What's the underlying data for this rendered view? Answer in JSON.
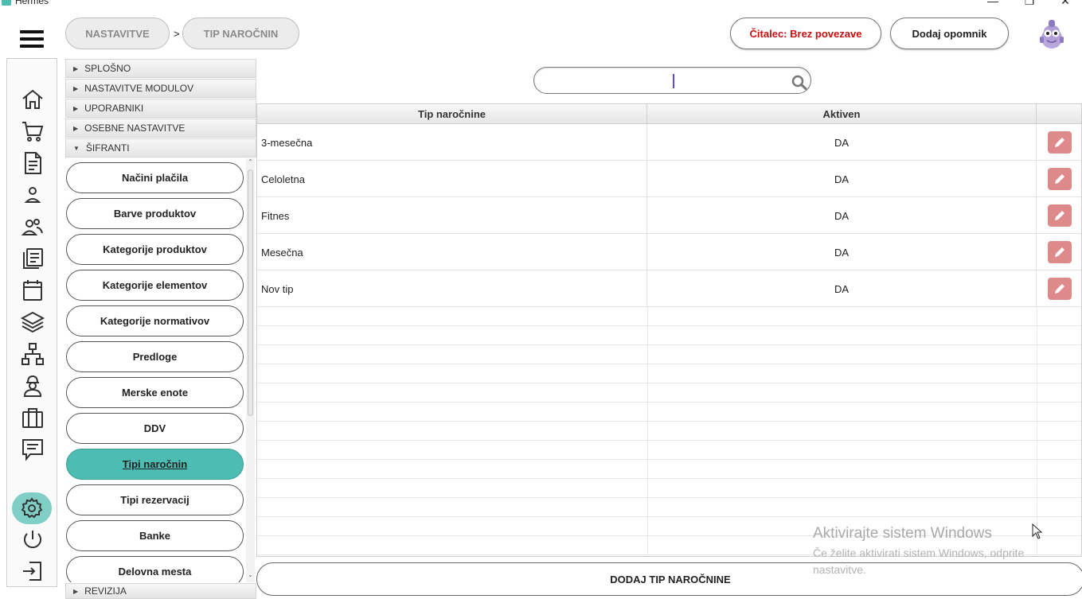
{
  "window": {
    "title": "Hermes",
    "minimize_glyph": "—",
    "maximize_glyph": "❐",
    "close_glyph": "✕"
  },
  "breadcrumb": {
    "items": [
      "NASTAVITVE",
      "TIP NAROČNIN"
    ],
    "separator": ">"
  },
  "header": {
    "reader_status": "Čitalec: Brez povezave",
    "add_reminder": "Dodaj opomnik"
  },
  "rail": {
    "icons": [
      "home-icon",
      "cart-icon",
      "document-icon",
      "person-icon",
      "group-icon",
      "reports-icon",
      "calendar-icon",
      "layers-icon",
      "network-icon",
      "worker-icon",
      "briefcase-icon",
      "chat-icon",
      "gear-icon",
      "power-icon",
      "logout-icon"
    ],
    "active": "gear-icon"
  },
  "tree": {
    "sections": [
      {
        "label": "SPLOŠNO",
        "expanded": false
      },
      {
        "label": "NASTAVITVE MODULOV",
        "expanded": false
      },
      {
        "label": "UPORABNIKI",
        "expanded": false
      },
      {
        "label": "OSEBNE NASTAVITVE",
        "expanded": false
      },
      {
        "label": "ŠIFRANTI",
        "expanded": true
      }
    ],
    "items": [
      "Načini plačila",
      "Barve produktov",
      "Kategorije produktov",
      "Kategorije elementov",
      "Kategorije normativov",
      "Predloge",
      "Merske enote",
      "DDV",
      "Tipi naročnin",
      "Tipi rezervacij",
      "Banke",
      "Delovna mesta"
    ],
    "active_item": "Tipi naročnin",
    "last_section": {
      "label": "REVIZIJA",
      "expanded": false
    }
  },
  "search": {
    "value": "",
    "placeholder": ""
  },
  "table": {
    "headers": [
      "Tip naročnine",
      "Aktiven",
      ""
    ],
    "rows": [
      {
        "name": "3-mesečna",
        "active": "DA"
      },
      {
        "name": "Celoletna",
        "active": "DA"
      },
      {
        "name": "Fitnes",
        "active": "DA"
      },
      {
        "name": "Mesečna",
        "active": "DA"
      },
      {
        "name": "Nov tip",
        "active": "DA"
      }
    ]
  },
  "add_button": "DODAJ TIP NAROČNINE",
  "watermark": {
    "title": "Aktivirajte sistem Windows",
    "text": "Če želite aktivirati sistem Windows, odprite nastavitve."
  },
  "colors": {
    "accent": "#4dbdb3",
    "accent_light": "#80cfc7",
    "edit": "#de8a8a",
    "status_error": "#c81010"
  }
}
